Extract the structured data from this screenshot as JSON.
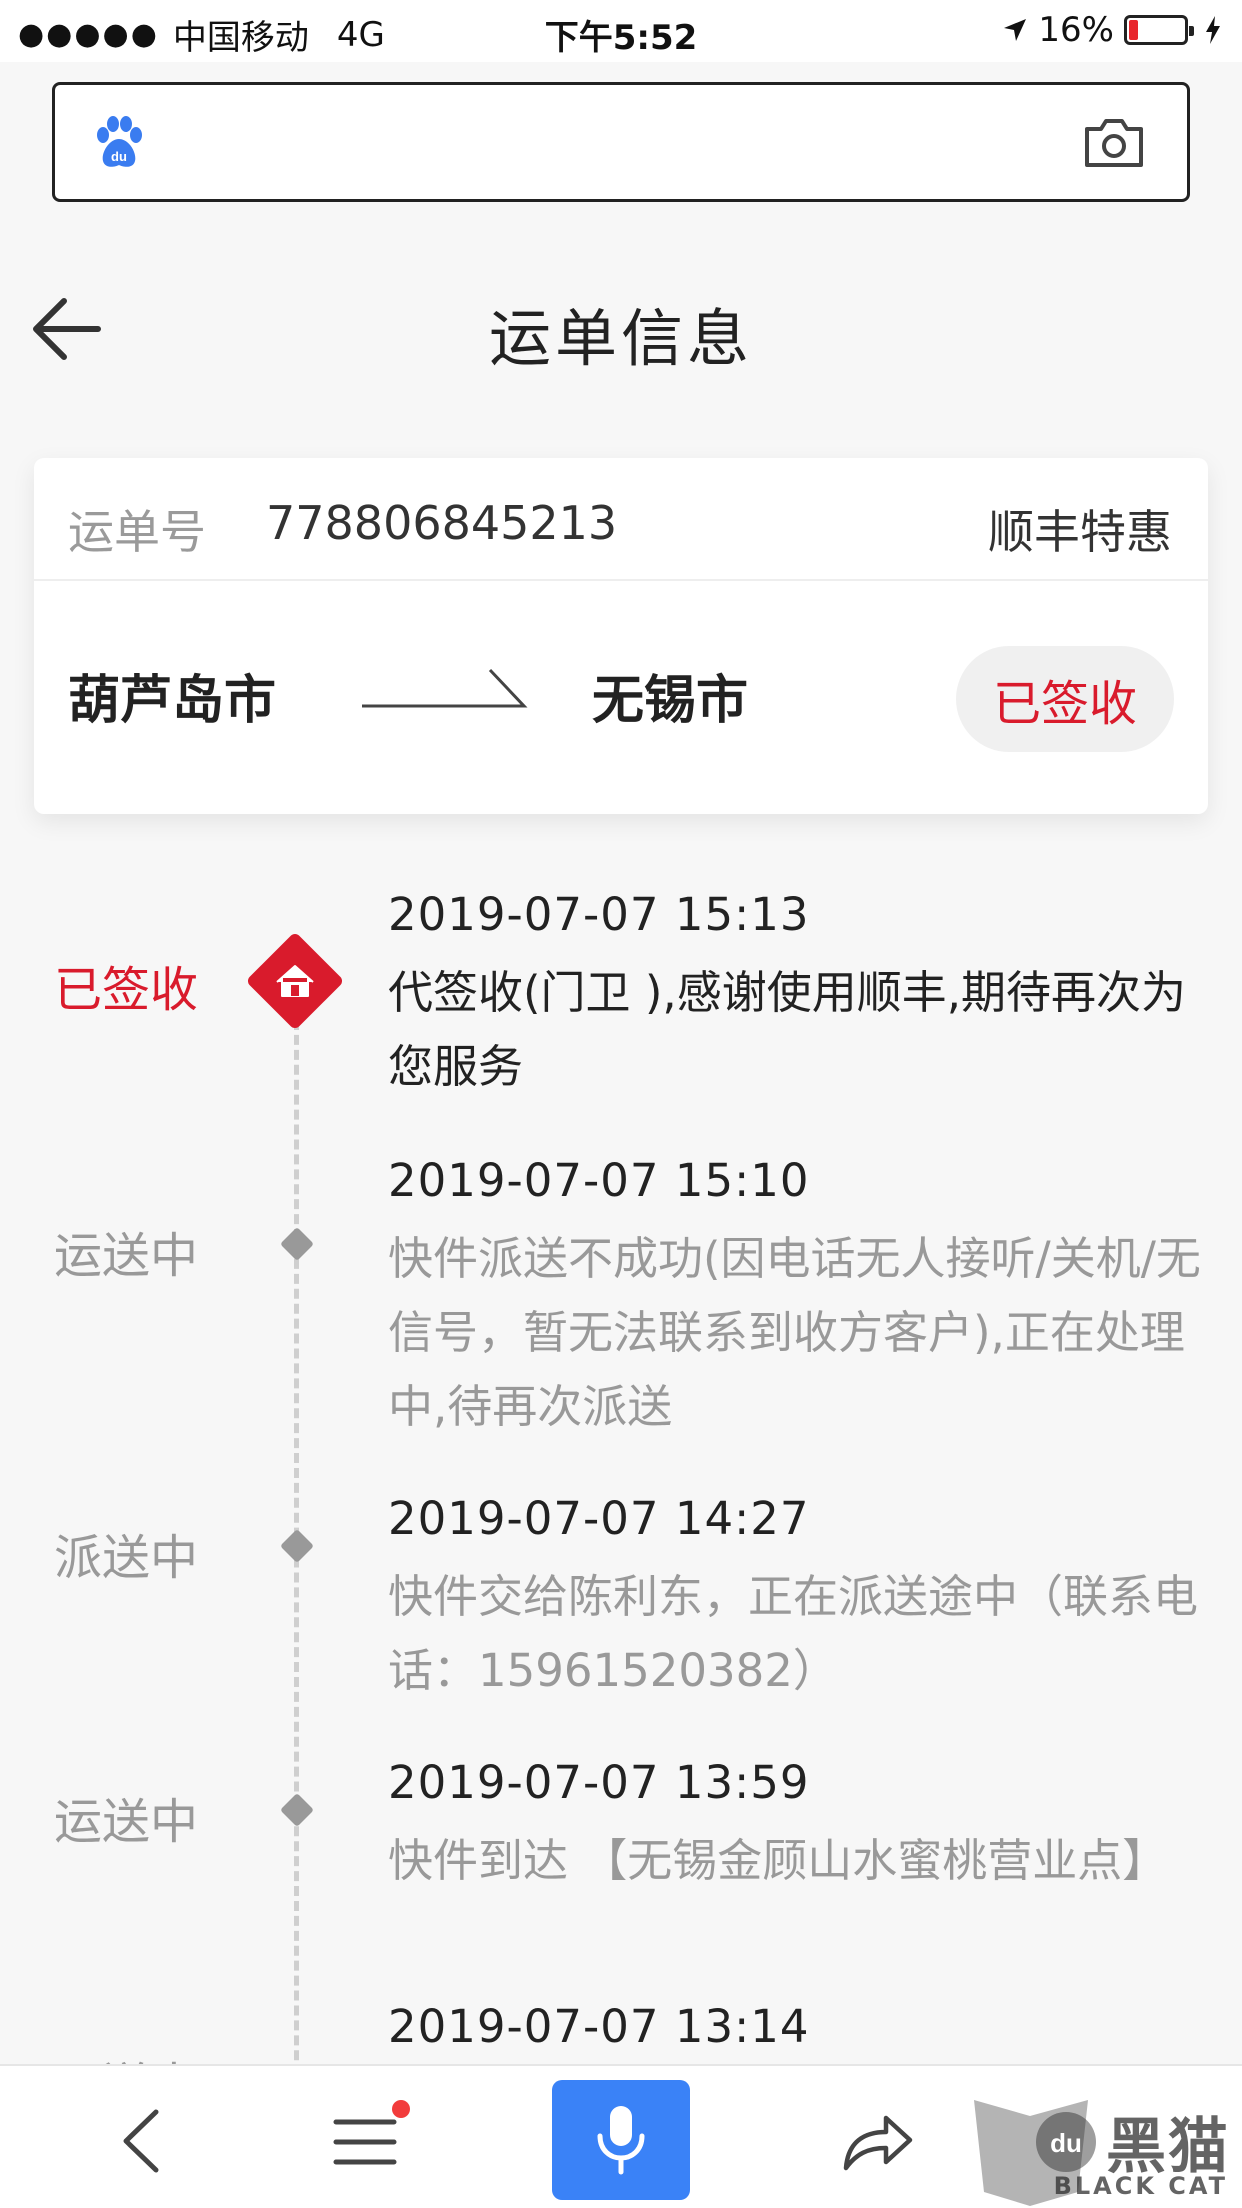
{
  "status_bar": {
    "signal_dots": "●●●●●",
    "carrier": "中国移动",
    "network": "4G",
    "time": "下午5:52",
    "battery_percent": "16%",
    "battery_level": 0.16
  },
  "search": {
    "placeholder": "",
    "logo_icon": "baidu-paw-icon",
    "camera_icon": "camera-icon"
  },
  "header": {
    "title": "运单信息",
    "back_icon": "arrow-left-icon"
  },
  "card": {
    "waybill_label": "运单号",
    "waybill_number": "778806845213",
    "carrier": "顺丰特惠",
    "origin": "葫芦岛市",
    "destination": "无锡市",
    "status": "已签收"
  },
  "timeline": [
    {
      "status": "已签收",
      "time": "2019-07-07 15:13",
      "description": "代签收(门卫 ),感谢使用顺丰,期待再次为您服务",
      "active": true
    },
    {
      "status": "运送中",
      "time": "2019-07-07 15:10",
      "description": "快件派送不成功(因电话无人接听/关机/无信号，暂无法联系到收方客户),正在处理中,待再次派送",
      "active": false
    },
    {
      "status": "派送中",
      "time": "2019-07-07 14:27",
      "description": "快件交给陈利东，正在派送途中（联系电话：15961520382）",
      "active": false
    },
    {
      "status": "运送中",
      "time": "2019-07-07 13:59",
      "description": "快件到达 【无锡金顾山水蜜桃营业点】",
      "active": false
    },
    {
      "status": "运送中",
      "time": "2019-07-07 13:14",
      "description": "",
      "active": false
    }
  ],
  "colors": {
    "accent_red": "#d91b2c",
    "voice_blue": "#3a82f7",
    "muted_gray": "#999999"
  },
  "bottom_bar": {
    "items": [
      "back-icon",
      "menu-icon",
      "microphone-icon",
      "share-icon"
    ]
  },
  "watermark": {
    "title": "黑猫",
    "subtitle": "BLACK CAT"
  }
}
